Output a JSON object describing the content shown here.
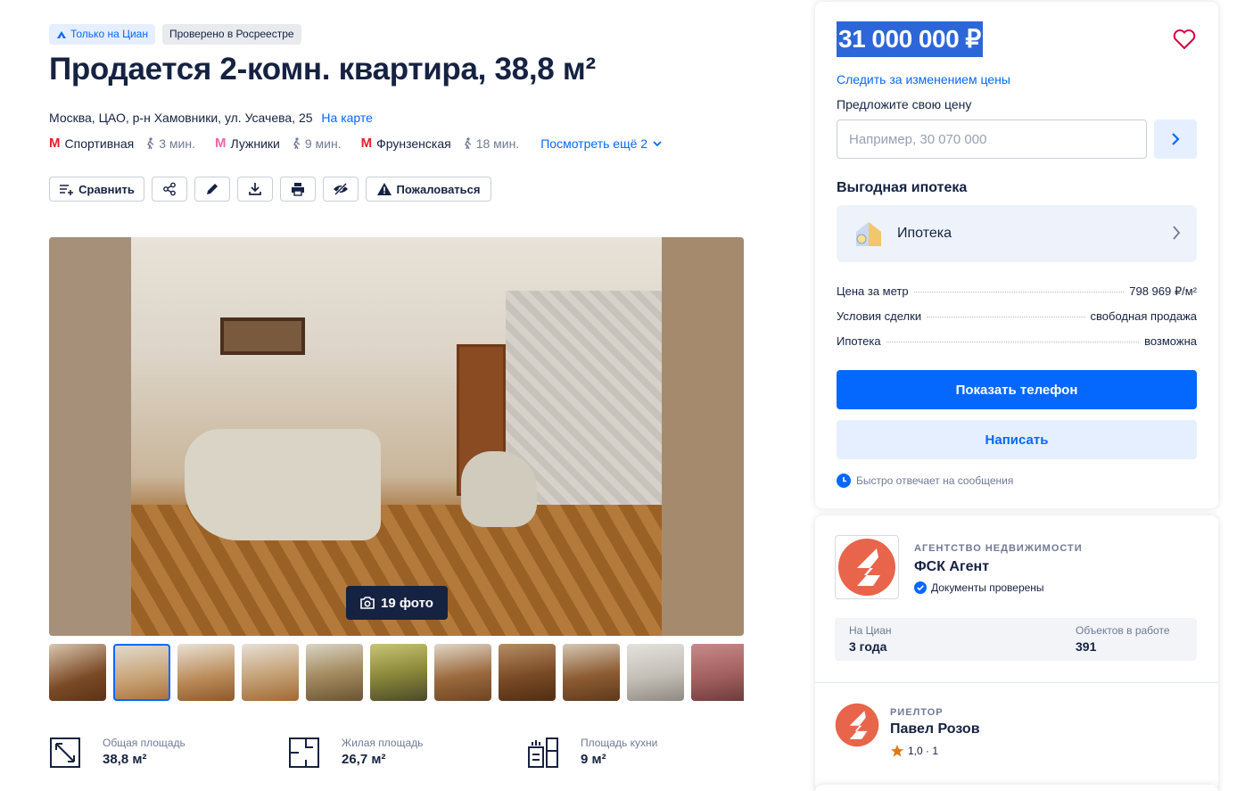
{
  "badges": {
    "cian": "Только на Циан",
    "rosreestr": "Проверено в Росреестре"
  },
  "title": "Продается 2-комн. квартира, 38,8 м²",
  "address": {
    "text": "Москва, ЦАО, р-н Хамовники, ул. Усачева, 25",
    "map_link": "На карте"
  },
  "metro": [
    {
      "name": "Спортивная",
      "time": "3 мин.",
      "color": "#e8202a"
    },
    {
      "name": "Лужники",
      "time": "9 мин.",
      "color": "#e86aa1"
    },
    {
      "name": "Фрунзенская",
      "time": "18 мин.",
      "color": "#e8202a"
    }
  ],
  "metro_more": "Посмотреть ещё 2",
  "actions": {
    "compare": "Сравнить",
    "report": "Пожаловаться",
    "icons": [
      "share-icon",
      "edit-icon",
      "download-icon",
      "print-icon",
      "hide-icon"
    ]
  },
  "gallery": {
    "count_label": "19 фото",
    "thumbnail_count": 11,
    "active_thumbnail": 2
  },
  "specs": [
    {
      "label": "Общая площадь",
      "value": "38,8 м²"
    },
    {
      "label": "Жилая площадь",
      "value": "26,7 м²"
    },
    {
      "label": "Площадь кухни",
      "value": "9 м²"
    }
  ],
  "price_card": {
    "price": "31 000 000 ₽",
    "follow": "Следить за изменением цены",
    "offer_label": "Предложите свою цену",
    "offer_placeholder": "Например, 30 070 000",
    "mortgage_title": "Выгодная ипотека",
    "mortgage_item": "Ипотека",
    "facts": [
      {
        "label": "Цена за метр",
        "value": "798 969 ₽/м²"
      },
      {
        "label": "Условия сделки",
        "value": "свободная продажа"
      },
      {
        "label": "Ипотека",
        "value": "возможна"
      }
    ],
    "show_phone": "Показать телефон",
    "write": "Написать",
    "fast_reply": "Быстро отвечает на сообщения"
  },
  "agency": {
    "type": "АГЕНТСТВО НЕДВИЖИМОСТИ",
    "name": "ФСК Агент",
    "verified": "Документы проверены",
    "on_cian_label": "На Циан",
    "on_cian_value": "3 года",
    "objects_label": "Объектов в работе",
    "objects_value": "391"
  },
  "realtor": {
    "type": "РИЕЛТОР",
    "name": "Павел Розов",
    "rating": "1,0 · 1"
  },
  "colors": {
    "accent": "#0468ff",
    "text": "#152242",
    "brand_logo": "#e8644a"
  }
}
